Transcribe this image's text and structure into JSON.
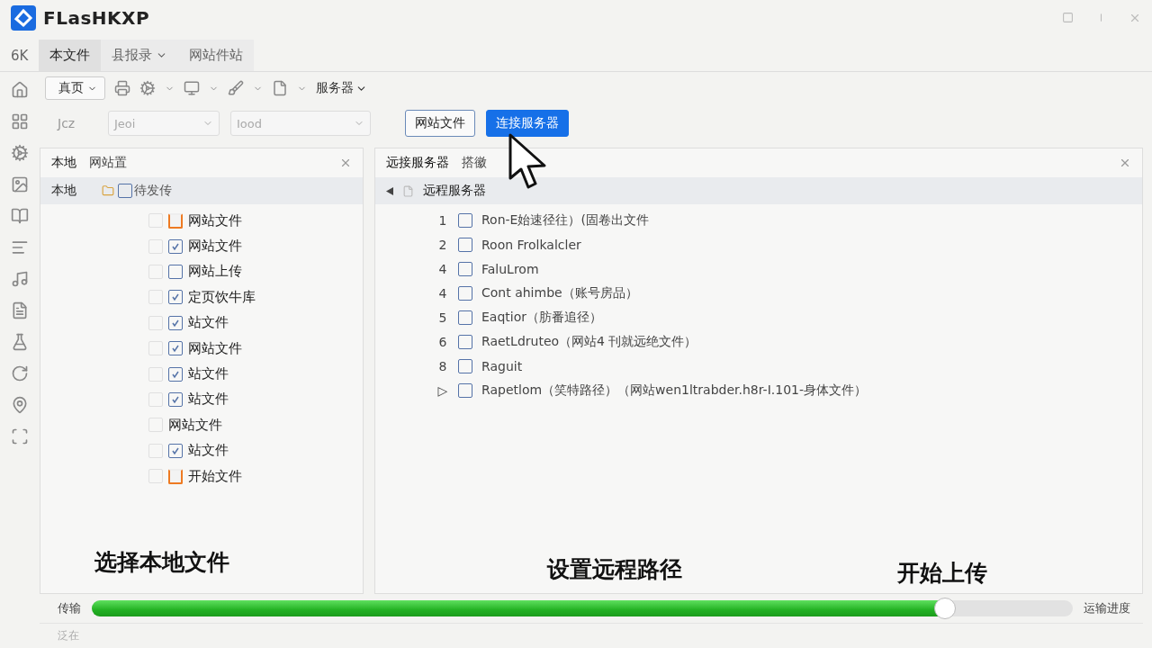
{
  "window": {
    "title": "FLasHKXP"
  },
  "menu_tabs": [
    {
      "label": "6K",
      "selected": false,
      "dropdown": false
    },
    {
      "label": "本文件",
      "selected": true,
      "dropdown": false
    },
    {
      "label": "县报录",
      "selected": false,
      "dropdown": true
    },
    {
      "label": "网站件站",
      "selected": false,
      "dropdown": false
    }
  ],
  "toolbar": {
    "home_label": "真页",
    "server_label": "服务器"
  },
  "address_bar": {
    "label": "Jcz",
    "combo_1": "Jeoi",
    "combo_2": "Iood",
    "buttons": [
      {
        "label": "网站文件",
        "kind": "outline"
      },
      {
        "label": "连接服务器",
        "kind": "primary"
      }
    ]
  },
  "local_panel": {
    "tabs": [
      "本地",
      "网站置"
    ],
    "header_label": "本地",
    "header_checked": false,
    "header_text": "待发传",
    "items": [
      {
        "label": "网站文件",
        "kind": "folder"
      },
      {
        "label": "网站文件",
        "kind": "check",
        "checked": true
      },
      {
        "label": "网站上传",
        "kind": "check",
        "checked": false
      },
      {
        "label": "定页饮牛库",
        "kind": "check",
        "checked": true
      },
      {
        "label": "站文件",
        "kind": "check",
        "checked": true
      },
      {
        "label": "网站文件",
        "kind": "check",
        "checked": true
      },
      {
        "label": "站文件",
        "kind": "check",
        "checked": true
      },
      {
        "label": "站文件",
        "kind": "check",
        "checked": true
      },
      {
        "label": "网站文件",
        "kind": "plain"
      },
      {
        "label": "站文件",
        "kind": "check",
        "checked": true
      },
      {
        "label": "开始文件",
        "kind": "folder"
      }
    ]
  },
  "remote_panel": {
    "tabs": [
      "远接服务器",
      "搭徽"
    ],
    "header_text": "远程服务器",
    "rows": [
      {
        "index": "1",
        "checked": false,
        "text": "Ron-E始速径往）(固卷出文件"
      },
      {
        "index": "2",
        "checked": false,
        "text": "Roon Frolkalcler"
      },
      {
        "index": "4",
        "checked": false,
        "text": "FaluLrom"
      },
      {
        "index": "4",
        "checked": false,
        "text": "Cont ahimbe（账号房品）"
      },
      {
        "index": "5",
        "checked": false,
        "text": "Eaqtior（肪番追径）"
      },
      {
        "index": "6",
        "checked": false,
        "text": "RaetLdruteo（网站4 刊就远绝文件）"
      },
      {
        "index": "8",
        "checked": false,
        "text": "Raguit"
      },
      {
        "index": "▷",
        "checked": false,
        "text": "Rapetlom（笑特路径）（网站wen1ltrabder.h8r-I.101-身体文件）"
      }
    ]
  },
  "annotations": [
    "选择本地文件",
    "设置远程路径",
    "开始上传"
  ],
  "transfer": {
    "label": "传输",
    "level": 0.87,
    "reading": "运输进度"
  },
  "status_bar": {
    "text": "泛在"
  }
}
